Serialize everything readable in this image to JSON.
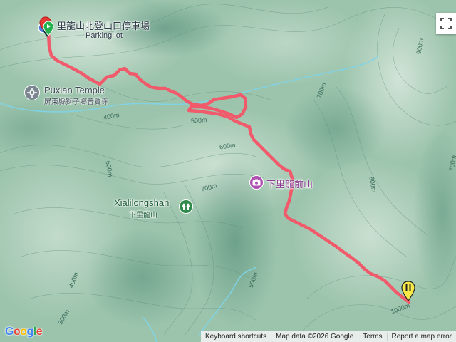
{
  "places": {
    "parking_zh": "里龍山北登山口停車場",
    "parking_en": "Parking lot",
    "temple_en": "Puxian Temple",
    "temple_zh": "屏東縣獅子鄉普賢寺",
    "xiali_front_zh": "下里龍前山",
    "xialilongshan_en": "Xialilongshan",
    "xialilongshan_zh": "下里龍山"
  },
  "contours": {
    "c400": "400m",
    "c500": "500m",
    "c600a": "600m",
    "c600b": "600m",
    "c700a": "700m",
    "c700b": "700m",
    "c700c": "700m",
    "c800": "800m",
    "c900": "900m",
    "c1000": "1000m",
    "c400b": "400m",
    "c300": "300m",
    "c500b": "500m"
  },
  "footer": {
    "keyboard": "Keyboard shortcuts",
    "map_data": "Map data ©2026 Google",
    "terms": "Terms",
    "report": "Report a map error"
  },
  "logo": "Google",
  "icons": {
    "start": "start-flag-icon",
    "end": "end-marker-icon",
    "temple": "temple-icon",
    "camera": "camera-icon",
    "park": "park-icon",
    "fullscreen": "fullscreen-icon"
  },
  "colors": {
    "track": "#f05a6a",
    "terrain": "#8fbba1",
    "stream": "#7fd3e6"
  }
}
